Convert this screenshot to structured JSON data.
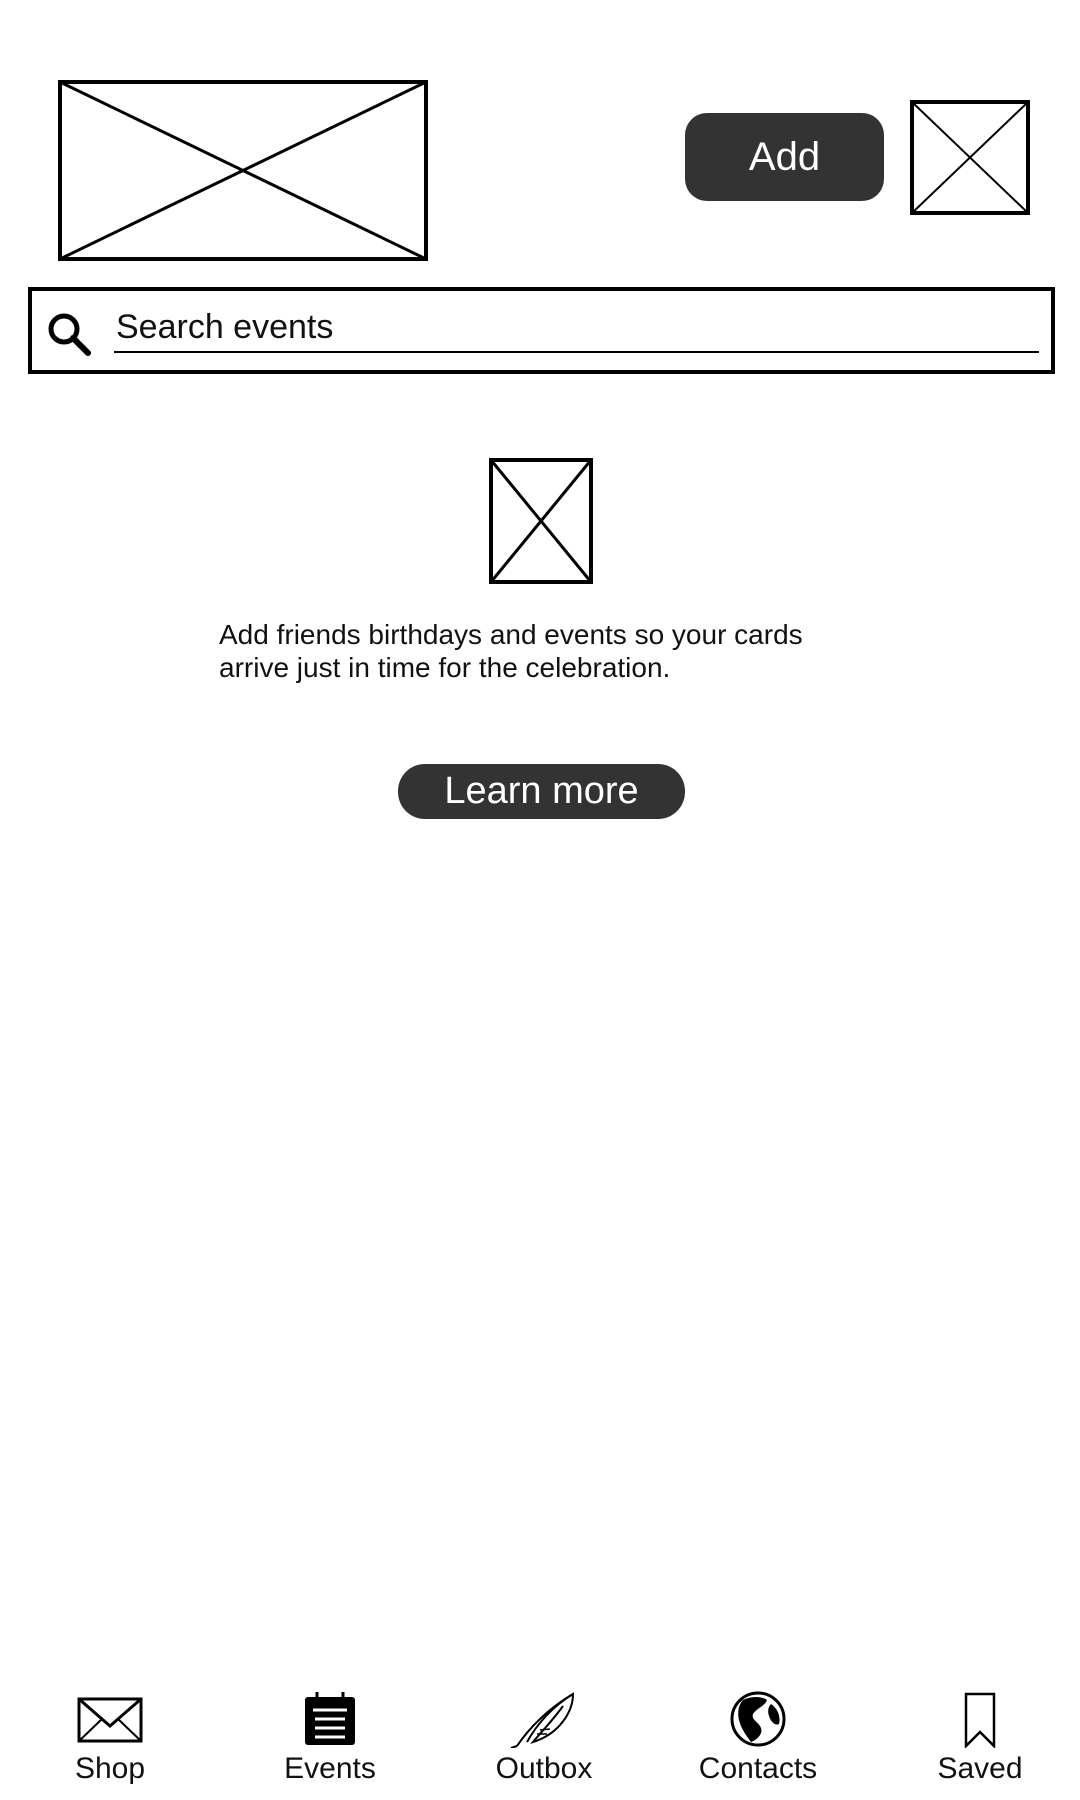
{
  "header": {
    "add_label": "Add"
  },
  "search": {
    "placeholder": "Search events",
    "value": ""
  },
  "empty_state": {
    "message": "Add friends birthdays and events so your cards arrive just in time for the celebration.",
    "learn_more_label": "Learn more"
  },
  "bottom_nav": {
    "items": [
      {
        "label": "Shop",
        "icon": "envelope-icon"
      },
      {
        "label": "Events",
        "icon": "calendar-icon"
      },
      {
        "label": "Outbox",
        "icon": "feather-icon"
      },
      {
        "label": "Contacts",
        "icon": "globe-icon"
      },
      {
        "label": "Saved",
        "icon": "bookmark-icon"
      }
    ]
  },
  "colors": {
    "button_bg": "#333333",
    "button_text": "#ffffff",
    "stroke": "#000000"
  }
}
